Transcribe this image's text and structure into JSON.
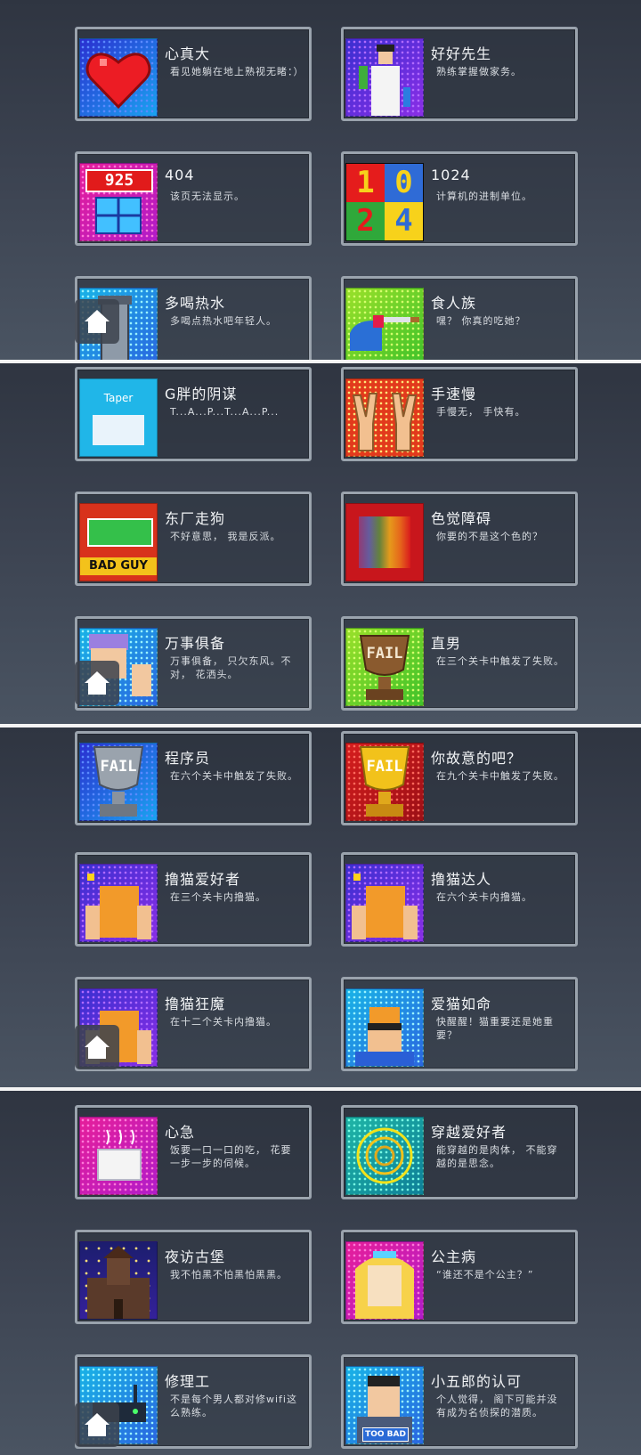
{
  "screens": [
    {
      "cards": [
        {
          "title": "心真大",
          "desc": "看见她躺在地上熟视无睹：）",
          "icon": "heart-icon"
        },
        {
          "title": "好好先生",
          "desc": "熟练掌握做家务。",
          "icon": "housework-man-icon"
        },
        {
          "title": "404",
          "desc": "该页无法显示。",
          "icon": "gift-404-icon",
          "badge": "925"
        },
        {
          "title": "1024",
          "desc": "计算机的进制单位。",
          "icon": "1024-blocks-icon",
          "blocks": [
            "1",
            "0",
            "2",
            "4"
          ]
        },
        {
          "title": "多喝热水",
          "desc": "多喝点热水吧年轻人。",
          "icon": "thermos-icon"
        },
        {
          "title": "食人族",
          "desc": "嘿？ 你真的吃她？",
          "icon": "knife-icon"
        }
      ]
    },
    {
      "cards": [
        {
          "title": "G胖的阴谋",
          "desc": "T...A...P...T...A...P...",
          "icon": "taper-icon",
          "badge": "Taper"
        },
        {
          "title": "手速慢",
          "desc": "手慢无， 手快有。",
          "icon": "victory-hands-icon"
        },
        {
          "title": "东厂走狗",
          "desc": "不好意思， 我是反派。",
          "icon": "bad-guy-icon",
          "badge": "BAD GUY"
        },
        {
          "title": "色觉障碍",
          "desc": "你要的不是这个色的？",
          "icon": "color-blind-icon"
        },
        {
          "title": "万事俱备",
          "desc": "万事俱备， 只欠东风。不对， 花洒头。",
          "icon": "worried-man-icon"
        },
        {
          "title": "直男",
          "desc": "在三个关卡中触发了失败。",
          "icon": "fail-trophy-bronze-icon",
          "badge": "FAIL"
        }
      ]
    },
    {
      "cards": [
        {
          "title": "程序员",
          "desc": "在六个关卡中触发了失败。",
          "icon": "fail-trophy-silver-icon",
          "badge": "FAIL"
        },
        {
          "title": "你故意的吧？",
          "desc": "在九个关卡中触发了失败。",
          "icon": "fail-trophy-gold-icon",
          "badge": "FAIL"
        },
        {
          "title": "撸猫爱好者",
          "desc": "在三个关卡内撸猫。",
          "icon": "cat-pet-icon"
        },
        {
          "title": "撸猫达人",
          "desc": "在六个关卡内撸猫。",
          "icon": "cat-pet-icon"
        },
        {
          "title": "撸猫狂魔",
          "desc": "在十二个关卡内撸猫。",
          "icon": "cat-pet-icon"
        },
        {
          "title": "爱猫如命",
          "desc": "快醒醒！猫重要还是她重要？",
          "icon": "cat-on-head-icon"
        }
      ]
    },
    {
      "cards": [
        {
          "title": "心急",
          "desc": "饭要一口一口的吃， 花要一步一步的伺候。",
          "icon": "tofu-icon"
        },
        {
          "title": "穿越爱好者",
          "desc": "能穿越的是肉体， 不能穿越的是思念。",
          "icon": "portal-icon"
        },
        {
          "title": "夜访古堡",
          "desc": "我不怕黑不怕黑怕黑黑。",
          "icon": "castle-icon"
        },
        {
          "title": "公主病",
          "desc": "“谁还不是个公主？”",
          "icon": "princess-icon"
        },
        {
          "title": "修理工",
          "desc": "不是每个男人都对修wifi这么熟练。",
          "icon": "router-icon"
        },
        {
          "title": "小五郎的认可",
          "desc": "个人觉得， 阁下可能并没有成为名侦探的潜质。",
          "icon": "detective-icon",
          "badge": "TOO BAD"
        }
      ]
    }
  ]
}
